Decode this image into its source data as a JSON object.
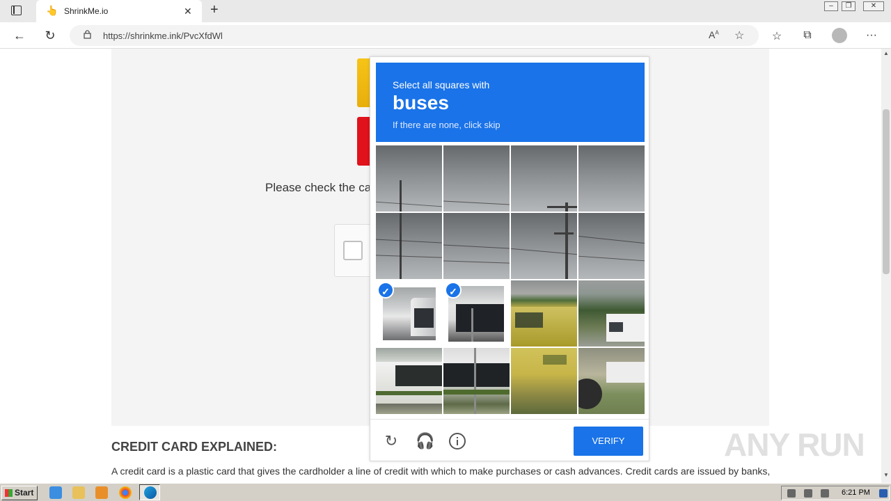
{
  "browser": {
    "tab_title": "ShrinkMe.io",
    "tab_favicon": "hand-emoji-icon",
    "new_tab_label": "+",
    "close_tab_label": "✕",
    "url": "https://shrinkme.ink/PvcXfdWl",
    "window_controls": [
      "minimize",
      "restore",
      "close"
    ]
  },
  "page": {
    "please_text": "Please check the ca",
    "section_heading": "CREDIT CARD EXPLAINED:",
    "section_body": "A credit card is a plastic card that gives the cardholder a line of credit with which to make purchases or cash advances. Credit cards are issued by banks, credit unions, and other financial institutions, and are typically used for short-term borrowing."
  },
  "captcha": {
    "instruction_line1": "Select all squares with",
    "target_word": "buses",
    "instruction_line3": "If there are none, click skip",
    "verify_label": "VERIFY",
    "selected_tiles": [
      8,
      9
    ],
    "tile_check_glyph": "✓",
    "footer_icons": [
      "reload-icon",
      "audio-headphones-icon",
      "info-icon"
    ],
    "header_color": "#1a73e8"
  },
  "watermark": "ANY RUN",
  "taskbar": {
    "start_label": "Start",
    "clock": "6:21 PM",
    "pinned_icons": [
      "ie-icon",
      "folder-icon",
      "media-player-icon",
      "chrome-icon",
      "edge-icon"
    ]
  }
}
